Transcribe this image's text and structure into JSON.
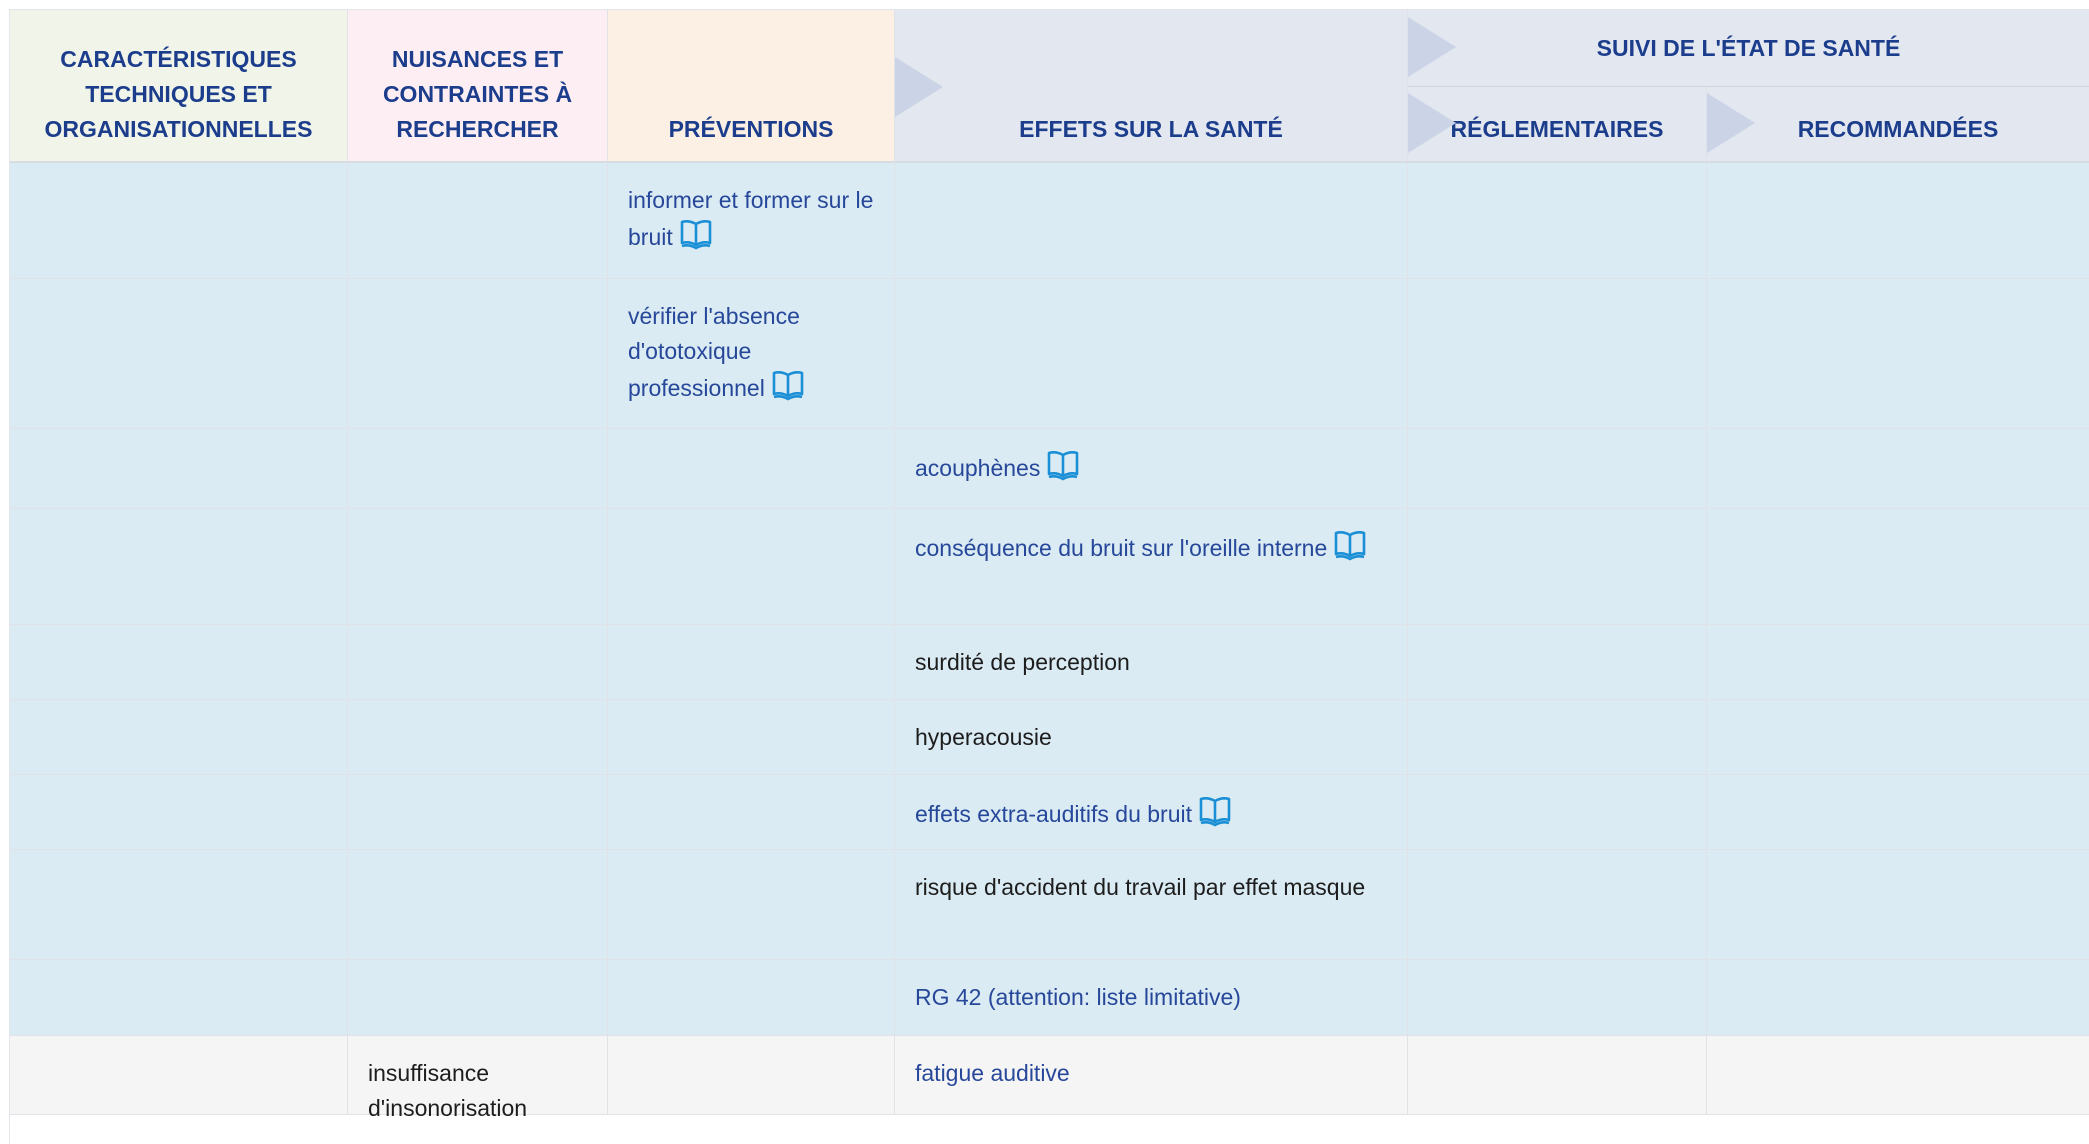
{
  "headers": {
    "tech": "CARACTÉRISTIQUES TECHNIQUES ET ORGANISATIONNELLES",
    "nuisances": "NUISANCES ET CONTRAINTES À RECHERCHER",
    "preventions": "PRÉVENTIONS",
    "effets": "EFFETS SUR LA SANTÉ",
    "suivi": "SUIVI DE L'ÉTAT DE SANTÉ",
    "reglementaires": "RÉGLEMENTAIRES",
    "recommandees": "RECOMMANDÉES"
  },
  "rows": [
    {
      "preventions": "informer et former sur le bruit",
      "preventions_icon": "book-icon"
    },
    {
      "preventions": "vérifier l'absence d'ototoxique professionnel",
      "preventions_icon": "book-icon"
    },
    {
      "effets": "acouphènes",
      "effets_icon": "book-icon"
    },
    {
      "effets": "conséquence du bruit sur l'oreille interne",
      "effets_icon": "book-icon"
    },
    {
      "effets": "surdité de perception"
    },
    {
      "effets": "hyperacousie"
    },
    {
      "effets": "effets extra-auditifs du bruit",
      "effets_icon": "book-icon"
    },
    {
      "effets": "risque d'accident du travail par effet masque"
    },
    {
      "effets": "RG 42 (attention: liste limitative)"
    },
    {
      "nuisances": "insuffisance d'insonorisation",
      "effets": "fatigue auditive"
    }
  ],
  "colors": {
    "header_text": "#1b3d8c",
    "link_text": "#27489a",
    "icon": "#1a8fd6",
    "row_bg_blue": "#daebf3",
    "row_bg_grey": "#f5f5f5"
  }
}
